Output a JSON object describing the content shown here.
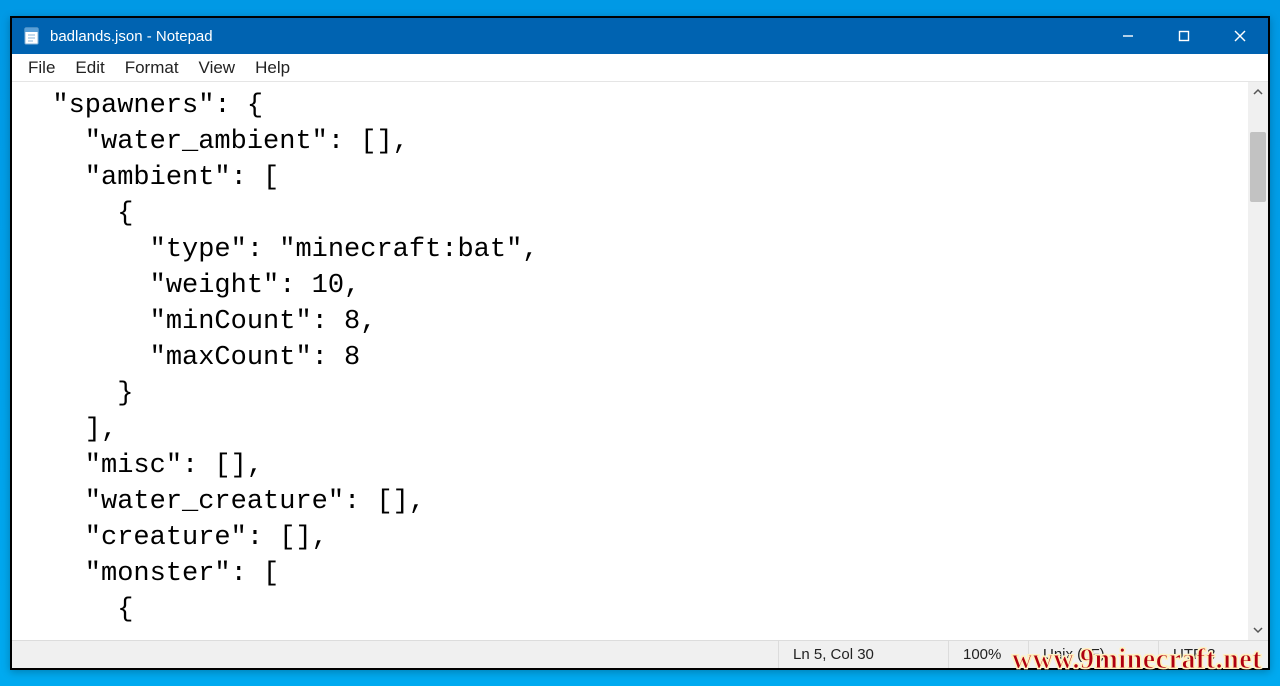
{
  "window": {
    "title": "badlands.json - Notepad"
  },
  "menu": {
    "file": "File",
    "edit": "Edit",
    "format": "Format",
    "view": "View",
    "help": "Help"
  },
  "editor": {
    "text": "  \"spawners\": {\n    \"water_ambient\": [],\n    \"ambient\": [\n      {\n        \"type\": \"minecraft:bat\",\n        \"weight\": 10,\n        \"minCount\": 8,\n        \"maxCount\": 8\n      }\n    ],\n    \"misc\": [],\n    \"water_creature\": [],\n    \"creature\": [],\n    \"monster\": [\n      {"
  },
  "status": {
    "position": "Ln 5, Col 30",
    "zoom": "100%",
    "lineending": "Unix (LF)",
    "encoding": "UTF-8"
  },
  "watermark": "www.9minecraft.net"
}
